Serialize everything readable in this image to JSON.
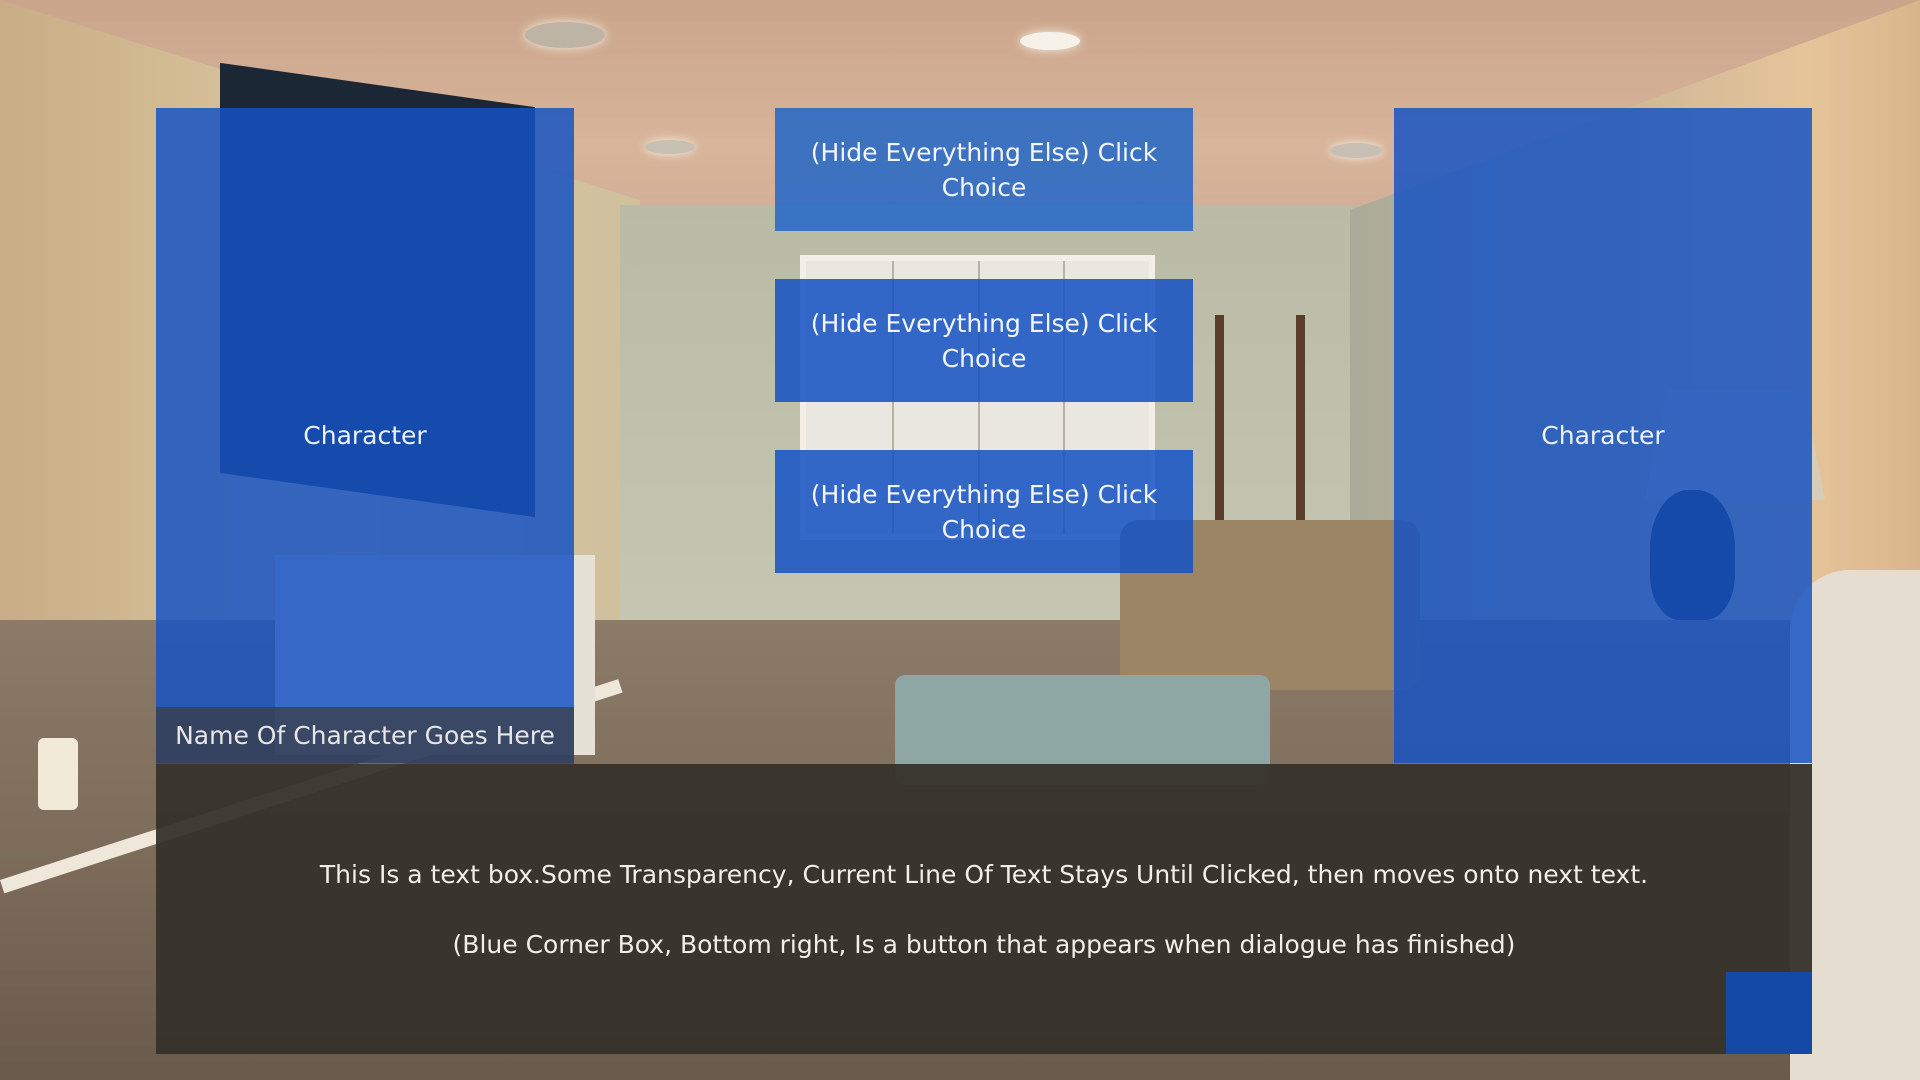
{
  "characters": {
    "left_label": "Character",
    "right_label": "Character",
    "name_plate": "Name Of Character Goes Here"
  },
  "choices": [
    {
      "label": "(Hide Everything Else) Click Choice"
    },
    {
      "label": "(Hide Everything Else) Click Choice"
    },
    {
      "label": "(Hide Everything Else) Click Choice"
    }
  ],
  "dialogue": {
    "line_1": "This Is a text box.Some Transparency, Current Line Of Text Stays Until Clicked, then moves onto next text.",
    "line_2": "(Blue Corner Box, Bottom right, Is a button that appears when dialogue has finished)"
  },
  "colors": {
    "panel_blue": "#1452c4",
    "dialogue_bg": "#36322a",
    "next_button": "#144aa6"
  }
}
